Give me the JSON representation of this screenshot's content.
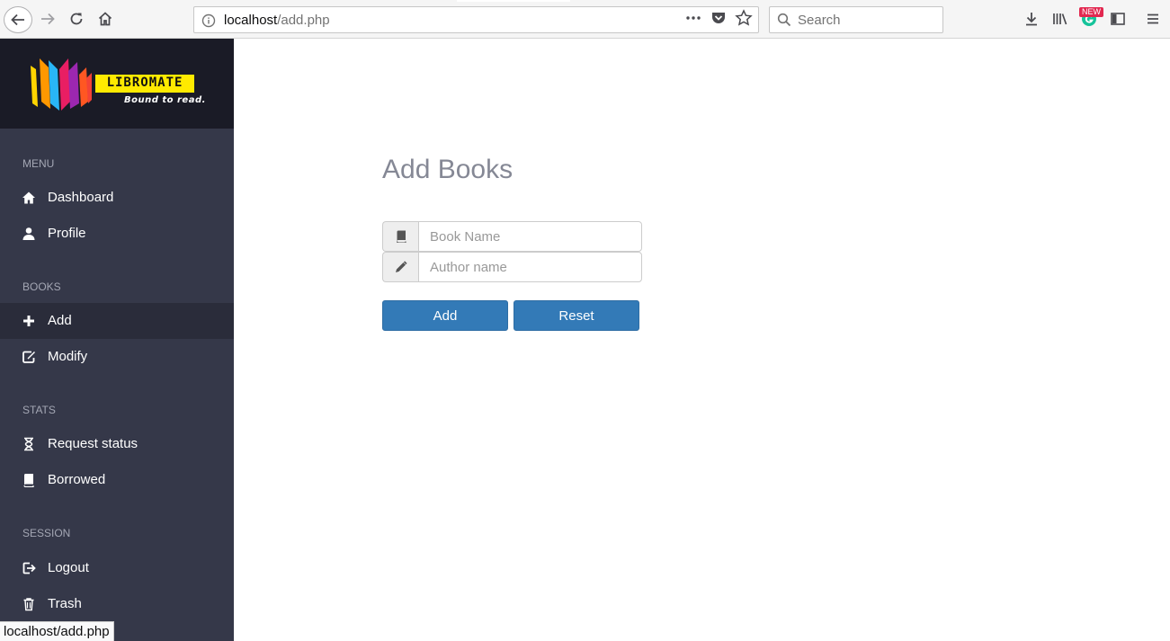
{
  "browser": {
    "url_host": "localhost",
    "url_path": "/add.php",
    "search_placeholder": "Search",
    "badge": "NEW",
    "status_url": "localhost/add.php"
  },
  "sidebar": {
    "logo_text": "LIBROMATE",
    "logo_tagline": "Bound to read.",
    "sections": [
      {
        "title": "MENU",
        "items": [
          {
            "label": "Dashboard",
            "icon": "home-icon"
          },
          {
            "label": "Profile",
            "icon": "user-icon"
          }
        ]
      },
      {
        "title": "BOOKS",
        "items": [
          {
            "label": "Add",
            "icon": "plus-icon",
            "active": true
          },
          {
            "label": "Modify",
            "icon": "edit-icon"
          }
        ]
      },
      {
        "title": "STATS",
        "items": [
          {
            "label": "Request status",
            "icon": "hourglass-icon"
          },
          {
            "label": "Borrowed",
            "icon": "book-icon"
          }
        ]
      },
      {
        "title": "SESSION",
        "items": [
          {
            "label": "Logout",
            "icon": "logout-icon"
          },
          {
            "label": "Trash",
            "icon": "trash-icon"
          }
        ]
      }
    ]
  },
  "main": {
    "title": "Add Books",
    "book_name_placeholder": "Book Name",
    "author_name_placeholder": "Author name",
    "add_label": "Add",
    "reset_label": "Reset"
  },
  "colors": {
    "sidebar_bg": "#353849",
    "logo_bg": "#1a1b26",
    "active_item_bg": "#2a2c3a",
    "button_primary": "#337ab7",
    "title_color": "#858895"
  }
}
